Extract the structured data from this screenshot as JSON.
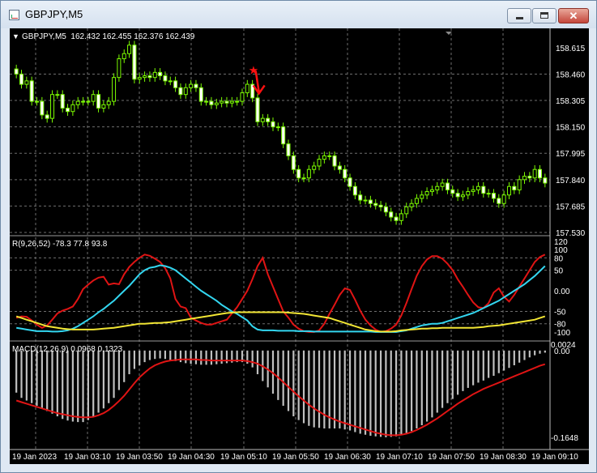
{
  "window": {
    "title": "GBPJPY,M5",
    "close_glyph": "✕",
    "icons": {
      "app": "chart-window-icon",
      "min": "minimize-icon",
      "max": "maximize-icon",
      "close": "close-icon"
    }
  },
  "chart_info": {
    "arrow": "▼",
    "header": "GBPJPY,M5  162.432 162.455 162.376 162.439"
  },
  "osc_label": "R(9,26,52) -78.3 77.8 93.8",
  "macd_label": "MACD(12,26,9) 0.0968 0.1323",
  "colors": {
    "background": "#000000",
    "grid": "#6e6e6e",
    "candle": "#7cfc00",
    "osc_red": "#e01414",
    "osc_cyan": "#33d6f0",
    "osc_yellow": "#f2e634",
    "macd_hist": "#c0c0c0",
    "macd_signal": "#e01414",
    "signal_marker": "#ff1111"
  },
  "chart_data": [
    {
      "type": "candlestick",
      "symbol": "GBPJPY",
      "timeframe": "M5",
      "ylim": [
        157.53,
        158.7
      ],
      "y_ticks": [
        "158.615",
        "158.460",
        "158.305",
        "158.150",
        "157.995",
        "157.840",
        "157.685",
        "157.530"
      ],
      "x_ticks": [
        "19 Jan 2023",
        "19 Jan 03:10",
        "19 Jan 03:50",
        "19 Jan 04:30",
        "19 Jan 05:10",
        "19 Jan 05:50",
        "19 Jan 06:30",
        "19 Jan 07:10",
        "19 Jan 07:50",
        "19 Jan 08:30",
        "19 Jan 09:10"
      ],
      "close": [
        158.46,
        158.4,
        158.42,
        158.3,
        158.3,
        158.22,
        158.2,
        158.34,
        158.34,
        158.26,
        158.24,
        158.28,
        158.3,
        158.3,
        158.3,
        158.34,
        158.26,
        158.28,
        158.3,
        158.44,
        158.55,
        158.58,
        158.63,
        158.43,
        158.44,
        158.45,
        158.44,
        158.47,
        158.45,
        158.42,
        158.42,
        158.38,
        158.34,
        158.38,
        158.4,
        158.38,
        158.3,
        158.3,
        158.28,
        158.29,
        158.3,
        158.29,
        158.3,
        158.3,
        158.35,
        158.4,
        158.32,
        158.18,
        158.2,
        158.18,
        158.15,
        158.15,
        158.05,
        157.98,
        157.9,
        157.85,
        157.85,
        157.9,
        157.92,
        157.96,
        157.98,
        157.98,
        157.92,
        157.9,
        157.85,
        157.8,
        157.75,
        157.72,
        157.72,
        157.7,
        157.69,
        157.68,
        157.65,
        157.62,
        157.6,
        157.64,
        157.68,
        157.7,
        157.73,
        157.75,
        157.77,
        157.78,
        157.8,
        157.82,
        157.78,
        157.76,
        157.74,
        157.75,
        157.77,
        157.78,
        157.8,
        157.76,
        157.76,
        157.73,
        157.7,
        157.75,
        157.8,
        157.78,
        157.84,
        157.86,
        157.85,
        157.9,
        157.85,
        157.82
      ],
      "marker": {
        "type": "sell_arrow",
        "bar_index": 46
      }
    },
    {
      "type": "line",
      "name": "R(9,26,52)",
      "ylim": [
        -110,
        120
      ],
      "y_ticks": [
        "120",
        "100",
        "80",
        "50",
        "0.00",
        "-50",
        "-80",
        "-100"
      ],
      "reference_levels": [
        -80,
        -50,
        50,
        80
      ],
      "series": [
        {
          "color": "osc_red",
          "values": [
            -66,
            -62,
            -63,
            -72,
            -82,
            -90,
            -84,
            -70,
            -55,
            -48,
            -44,
            -38,
            -20,
            4,
            15,
            25,
            32,
            34,
            15,
            18,
            16,
            40,
            58,
            70,
            80,
            88,
            85,
            78,
            70,
            55,
            30,
            -20,
            -38,
            -42,
            -65,
            -72,
            -78,
            -82,
            -82,
            -78,
            -74,
            -70,
            -55,
            -40,
            -20,
            0,
            28,
            60,
            80,
            40,
            10,
            -20,
            -50,
            -65,
            -82,
            -92,
            -98,
            -100,
            -100,
            -96,
            -80,
            -56,
            -34,
            -10,
            6,
            2,
            -22,
            -48,
            -70,
            -84,
            -94,
            -100,
            -98,
            -92,
            -82,
            -60,
            -30,
            4,
            36,
            60,
            76,
            84,
            84,
            78,
            66,
            50,
            28,
            10,
            -10,
            -28,
            -40,
            -42,
            -30,
            -4,
            6,
            -14,
            -26,
            -10,
            10,
            30,
            50,
            70,
            82,
            88
          ]
        },
        {
          "color": "osc_cyan",
          "values": [
            -90,
            -92,
            -94,
            -96,
            -98,
            -98,
            -98,
            -99,
            -99,
            -98,
            -96,
            -92,
            -86,
            -78,
            -70,
            -62,
            -52,
            -44,
            -34,
            -24,
            -12,
            0,
            12,
            26,
            40,
            50,
            56,
            58,
            62,
            60,
            56,
            50,
            40,
            30,
            20,
            10,
            0,
            -8,
            -16,
            -24,
            -34,
            -42,
            -50,
            -56,
            -64,
            -72,
            -86,
            -94,
            -96,
            -96,
            -96,
            -97,
            -97,
            -97,
            -97,
            -98,
            -98,
            -98,
            -99,
            -99,
            -99,
            -99,
            -99,
            -99,
            -99,
            -99,
            -99,
            -99,
            -99,
            -99,
            -100,
            -100,
            -100,
            -100,
            -100,
            -98,
            -96,
            -92,
            -88,
            -84,
            -82,
            -80,
            -80,
            -78,
            -74,
            -70,
            -66,
            -62,
            -58,
            -54,
            -48,
            -42,
            -36,
            -30,
            -24,
            -16,
            -8,
            0,
            8,
            16,
            26,
            36,
            48,
            60
          ]
        },
        {
          "color": "osc_yellow",
          "values": [
            -62,
            -66,
            -70,
            -74,
            -78,
            -82,
            -86,
            -88,
            -90,
            -92,
            -93,
            -94,
            -94,
            -94,
            -94,
            -94,
            -93,
            -92,
            -91,
            -90,
            -88,
            -86,
            -84,
            -82,
            -80,
            -80,
            -79,
            -78,
            -78,
            -77,
            -76,
            -74,
            -72,
            -70,
            -68,
            -66,
            -64,
            -62,
            -60,
            -58,
            -56,
            -54,
            -53,
            -52,
            -52,
            -52,
            -52,
            -52,
            -52,
            -52,
            -52,
            -52,
            -52,
            -53,
            -54,
            -55,
            -56,
            -58,
            -60,
            -62,
            -64,
            -66,
            -70,
            -74,
            -78,
            -82,
            -86,
            -90,
            -94,
            -96,
            -98,
            -99,
            -99,
            -99,
            -98,
            -96,
            -95,
            -94,
            -93,
            -92,
            -92,
            -91,
            -91,
            -90,
            -90,
            -90,
            -90,
            -90,
            -90,
            -90,
            -89,
            -88,
            -86,
            -85,
            -84,
            -82,
            -80,
            -78,
            -76,
            -74,
            -72,
            -70,
            -66,
            -62
          ]
        }
      ]
    },
    {
      "type": "bar",
      "name": "MACD(12,26,9)",
      "ylim": [
        -0.185,
        0.012
      ],
      "y_ticks": [
        "0.0024",
        "0.00",
        "-0.1648"
      ],
      "series": [
        {
          "color": "macd_hist",
          "values": [
            -0.08,
            -0.09,
            -0.095,
            -0.1,
            -0.105,
            -0.11,
            -0.115,
            -0.12,
            -0.125,
            -0.13,
            -0.133,
            -0.135,
            -0.136,
            -0.136,
            -0.132,
            -0.125,
            -0.118,
            -0.11,
            -0.1,
            -0.09,
            -0.075,
            -0.06,
            -0.045,
            -0.035,
            -0.028,
            -0.022,
            -0.018,
            -0.016,
            -0.015,
            -0.016,
            -0.018,
            -0.02,
            -0.022,
            -0.024,
            -0.025,
            -0.026,
            -0.027,
            -0.027,
            -0.027,
            -0.026,
            -0.025,
            -0.024,
            -0.023,
            -0.022,
            -0.022,
            -0.025,
            -0.032,
            -0.045,
            -0.058,
            -0.07,
            -0.082,
            -0.094,
            -0.105,
            -0.115,
            -0.125,
            -0.132,
            -0.138,
            -0.143,
            -0.146,
            -0.147,
            -0.148,
            -0.148,
            -0.148,
            -0.148,
            -0.15,
            -0.152,
            -0.155,
            -0.158,
            -0.16,
            -0.162,
            -0.163,
            -0.164,
            -0.1648,
            -0.164,
            -0.163,
            -0.16,
            -0.157,
            -0.153,
            -0.148,
            -0.142,
            -0.135,
            -0.127,
            -0.118,
            -0.109,
            -0.1,
            -0.092,
            -0.084,
            -0.077,
            -0.071,
            -0.066,
            -0.061,
            -0.057,
            -0.052,
            -0.048,
            -0.043,
            -0.038,
            -0.033,
            -0.028,
            -0.023,
            -0.018,
            -0.013,
            -0.009,
            -0.006,
            -0.004
          ]
        },
        {
          "color": "macd_signal",
          "values": [
            -0.095,
            -0.098,
            -0.101,
            -0.104,
            -0.107,
            -0.11,
            -0.113,
            -0.116,
            -0.119,
            -0.121,
            -0.123,
            -0.125,
            -0.126,
            -0.127,
            -0.127,
            -0.126,
            -0.123,
            -0.119,
            -0.113,
            -0.105,
            -0.096,
            -0.086,
            -0.074,
            -0.062,
            -0.051,
            -0.042,
            -0.034,
            -0.028,
            -0.024,
            -0.021,
            -0.019,
            -0.018,
            -0.017,
            -0.017,
            -0.017,
            -0.017,
            -0.018,
            -0.018,
            -0.019,
            -0.019,
            -0.019,
            -0.019,
            -0.019,
            -0.019,
            -0.019,
            -0.02,
            -0.022,
            -0.025,
            -0.03,
            -0.036,
            -0.043,
            -0.051,
            -0.06,
            -0.069,
            -0.078,
            -0.087,
            -0.095,
            -0.103,
            -0.11,
            -0.116,
            -0.122,
            -0.127,
            -0.131,
            -0.135,
            -0.138,
            -0.141,
            -0.144,
            -0.147,
            -0.15,
            -0.153,
            -0.156,
            -0.158,
            -0.16,
            -0.161,
            -0.161,
            -0.16,
            -0.158,
            -0.155,
            -0.151,
            -0.146,
            -0.141,
            -0.135,
            -0.129,
            -0.122,
            -0.115,
            -0.108,
            -0.101,
            -0.095,
            -0.089,
            -0.083,
            -0.078,
            -0.073,
            -0.069,
            -0.065,
            -0.061,
            -0.057,
            -0.053,
            -0.049,
            -0.045,
            -0.041,
            -0.037,
            -0.033,
            -0.029,
            -0.026
          ]
        }
      ]
    }
  ]
}
